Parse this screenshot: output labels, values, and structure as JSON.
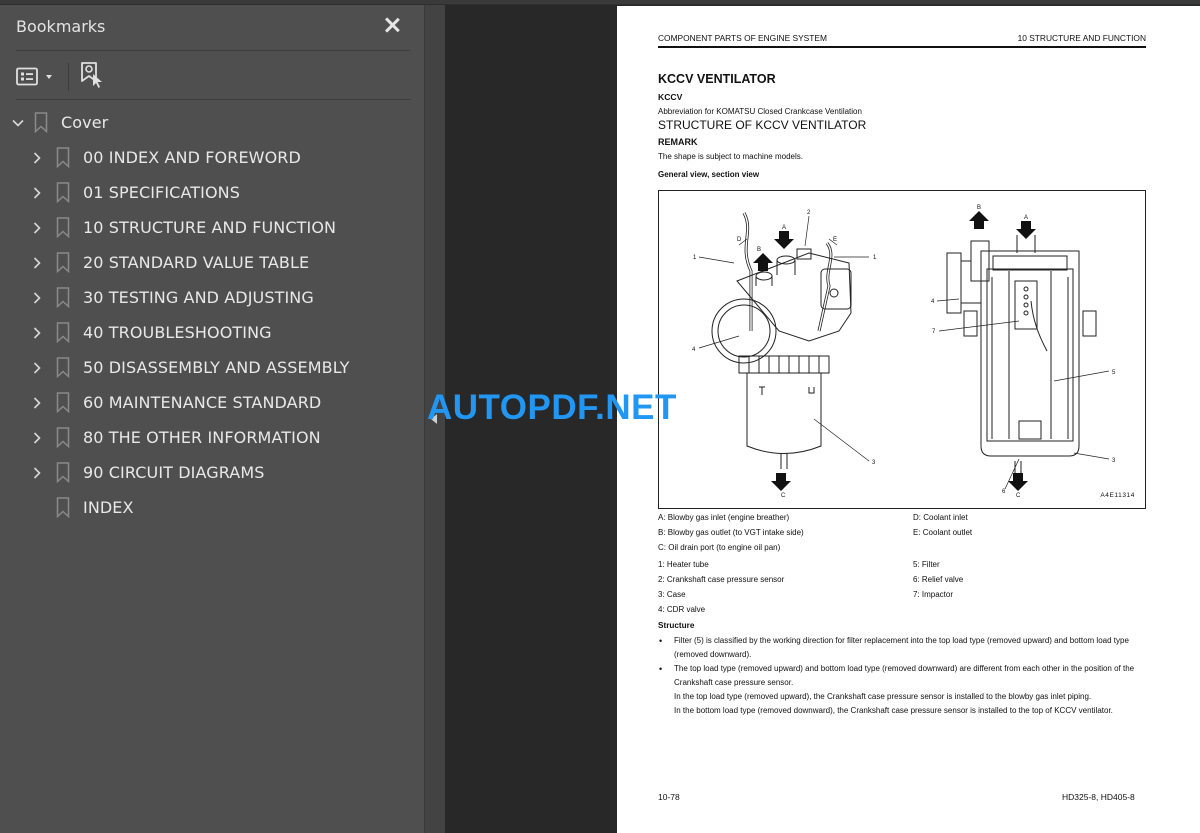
{
  "sidebar": {
    "title": "Bookmarks",
    "items": [
      {
        "label": "Cover",
        "expanded": true,
        "level": 0
      },
      {
        "label": "00 INDEX AND FOREWORD",
        "level": 1
      },
      {
        "label": "01 SPECIFICATIONS",
        "level": 1
      },
      {
        "label": "10 STRUCTURE AND FUNCTION",
        "level": 1
      },
      {
        "label": "20 STANDARD VALUE TABLE",
        "level": 1
      },
      {
        "label": "30 TESTING AND ADJUSTING",
        "level": 1
      },
      {
        "label": "40 TROUBLESHOOTING",
        "level": 1
      },
      {
        "label": "50 DISASSEMBLY AND ASSEMBLY",
        "level": 1
      },
      {
        "label": "60 MAINTENANCE STANDARD",
        "level": 1
      },
      {
        "label": "80 THE OTHER INFORMATION",
        "level": 1
      },
      {
        "label": "90 CIRCUIT DIAGRAMS",
        "level": 1
      },
      {
        "label": "INDEX",
        "level": 1,
        "leaf": true
      }
    ]
  },
  "page": {
    "header_left": "COMPONENT PARTS OF ENGINE SYSTEM",
    "header_right": "10 STRUCTURE AND FUNCTION",
    "title": "KCCV VENTILATOR",
    "subtitle": "KCCV",
    "abbreviation": "Abbreviation for KOMATSU Closed Crankcase Ventilation",
    "section": "STRUCTURE OF KCCV VENTILATOR",
    "remark_label": "REMARK",
    "remark_text": "The shape is subject to machine models.",
    "figure_caption": "General view, section view",
    "figure_code": "A4E11314",
    "figure_labels": {
      "A": "A",
      "B": "B",
      "C": "C",
      "D": "D",
      "E": "E",
      "n1": "1",
      "n2": "2",
      "n3": "3",
      "n4": "4",
      "n5": "5",
      "n6": "6",
      "n7": "7"
    },
    "ports_left": [
      "A: Blowby gas inlet (engine breather)",
      "B: Blowby gas outlet (to VGT intake side)",
      "C: Oil drain port (to engine oil pan)"
    ],
    "ports_right": [
      "D: Coolant inlet",
      "E: Coolant outlet"
    ],
    "parts_left": [
      "1: Heater tube",
      "2: Crankshaft case pressure sensor",
      "3: Case",
      "4: CDR valve"
    ],
    "parts_right": [
      "5: Filter",
      "6: Relief valve",
      "7: Impactor"
    ],
    "structure_label": "Structure",
    "bullets": [
      "Filter (5) is classified by the working direction for filter replacement into the top load type (removed upward) and bottom load type (removed downward).",
      "The top load type (removed upward) and bottom load type (removed downward) are different from each other in the position of the Crankshaft case pressure sensor."
    ],
    "sub_lines": [
      "In the top load type (removed upward), the Crankshaft case pressure sensor is installed to the blowby gas inlet piping.",
      "In the bottom load type (removed downward), the Crankshaft case pressure sensor is installed to the top of KCCV ventilator."
    ],
    "footer_left": "10-78",
    "footer_right": "HD325-8, HD405-8"
  },
  "watermark": "AUTOPDF.NET"
}
